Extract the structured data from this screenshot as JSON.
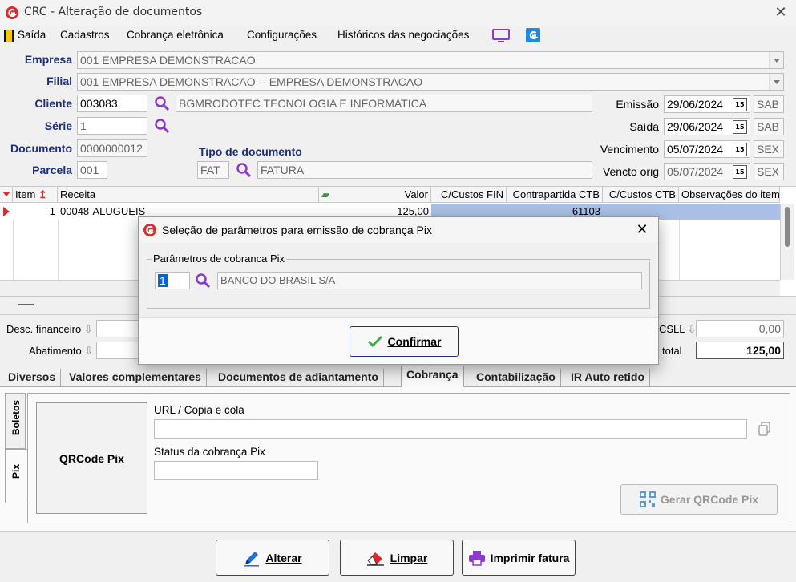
{
  "window": {
    "title": "CRC - Alteração de documentos",
    "close": "✕"
  },
  "menu": {
    "items": [
      "Saída",
      "Cadastros",
      "Cobrança eletrônica",
      "Configurações",
      "Históricos das negociações"
    ]
  },
  "header": {
    "empresa_label": "Empresa",
    "empresa_value": "001 EMPRESA DEMONSTRACAO",
    "filial_label": "Filial",
    "filial_value": "001 EMPRESA DEMONSTRACAO -- EMPRESA DEMONSTRACAO",
    "cliente_label": "Cliente",
    "cliente_code": "003083",
    "cliente_name": "BGMRODOTEC TECNOLOGIA E INFORMATICA",
    "serie_label": "Série",
    "serie_value": "1",
    "documento_label": "Documento",
    "documento_value": "0000000012",
    "parcela_label": "Parcela",
    "parcela_value": "001",
    "tipo_label": "Tipo de documento",
    "tipo_code": "FAT",
    "tipo_name": "FATURA",
    "emissao_label": "Emissão",
    "emissao_date": "29/06/2024",
    "emissao_day": "SAB",
    "saida_label": "Saída",
    "saida_date": "29/06/2024",
    "saida_day": "SAB",
    "vencimento_label": "Vencimento",
    "vencimento_date": "05/07/2024",
    "vencimento_day": "SEX",
    "vencto_orig_label": "Vencto orig",
    "vencto_orig_date": "05/07/2024",
    "vencto_orig_day": "SEX"
  },
  "grid": {
    "columns": [
      "Item",
      "Receita",
      "Valor",
      "C/Custos FIN",
      "Contrapartida CTB",
      "C/Custos CTB",
      "Observações do item"
    ],
    "row": {
      "item": "1",
      "receita": "00048-ALUGUEIS",
      "valor": "125,00",
      "contrapartida": "61103"
    }
  },
  "totals": {
    "desc_label": "Desc. financeiro",
    "abat_label": "Abatimento",
    "csll_label": "CSLL",
    "csll_value": "0,00",
    "total_label": "total",
    "total_value": "125,00"
  },
  "tabs": [
    "Diversos",
    "Valores complementares",
    "Documentos de adiantamento",
    "Cobrança",
    "Contabilização",
    "IR Auto retido"
  ],
  "vtabs": [
    "Boletos",
    "Pix"
  ],
  "pix": {
    "qr_label": "QRCode Pix",
    "url_label": "URL / Copia e cola",
    "status_label": "Status da cobrança Pix",
    "gerar_label": "Gerar QRCode Pix"
  },
  "dialog": {
    "title": "Seleção de parâmetros para emissão de cobrança Pix",
    "group_label": "Parâmetros de cobranca Pix",
    "param_code": "1",
    "param_name": "BANCO DO BRASIL S/A",
    "confirm_label": "Confirmar"
  },
  "footer": {
    "alterar": "Alterar",
    "limpar": "Limpar",
    "imprimir": "Imprimir fatura"
  },
  "colors": {
    "label_blue": "#1c2f7a",
    "selection": "#a9bfe6",
    "accent_red": "#d32f2f",
    "icon_purple": "#8a3cc8"
  }
}
